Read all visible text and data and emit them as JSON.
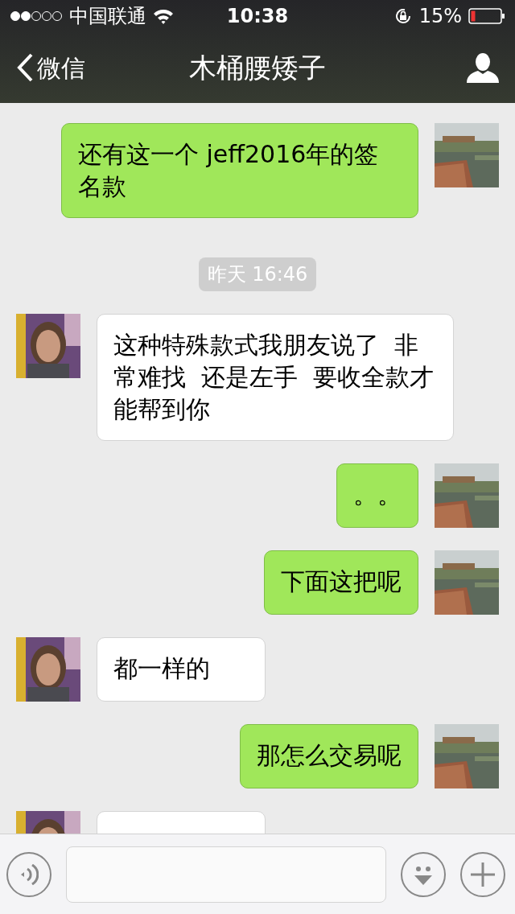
{
  "status_bar": {
    "carrier": "中国联通",
    "time": "10:38",
    "battery": "15%"
  },
  "nav": {
    "back": "微信",
    "title": "木桶腰矮子"
  },
  "messages": [
    {
      "kind": "sent",
      "text": "还有这一个 jeff2016年的签名款"
    },
    {
      "kind": "time",
      "text": "昨天 16:46"
    },
    {
      "kind": "received",
      "text": "这种特殊款式我朋友说了  非常难找  还是左手  要收全款才能帮到你"
    },
    {
      "kind": "sent",
      "text": "。。"
    },
    {
      "kind": "sent",
      "text": "下面这把呢"
    },
    {
      "kind": "received",
      "text": "都一样的"
    },
    {
      "kind": "sent",
      "text": "那怎么交易呢"
    },
    {
      "kind": "received"
    }
  ]
}
